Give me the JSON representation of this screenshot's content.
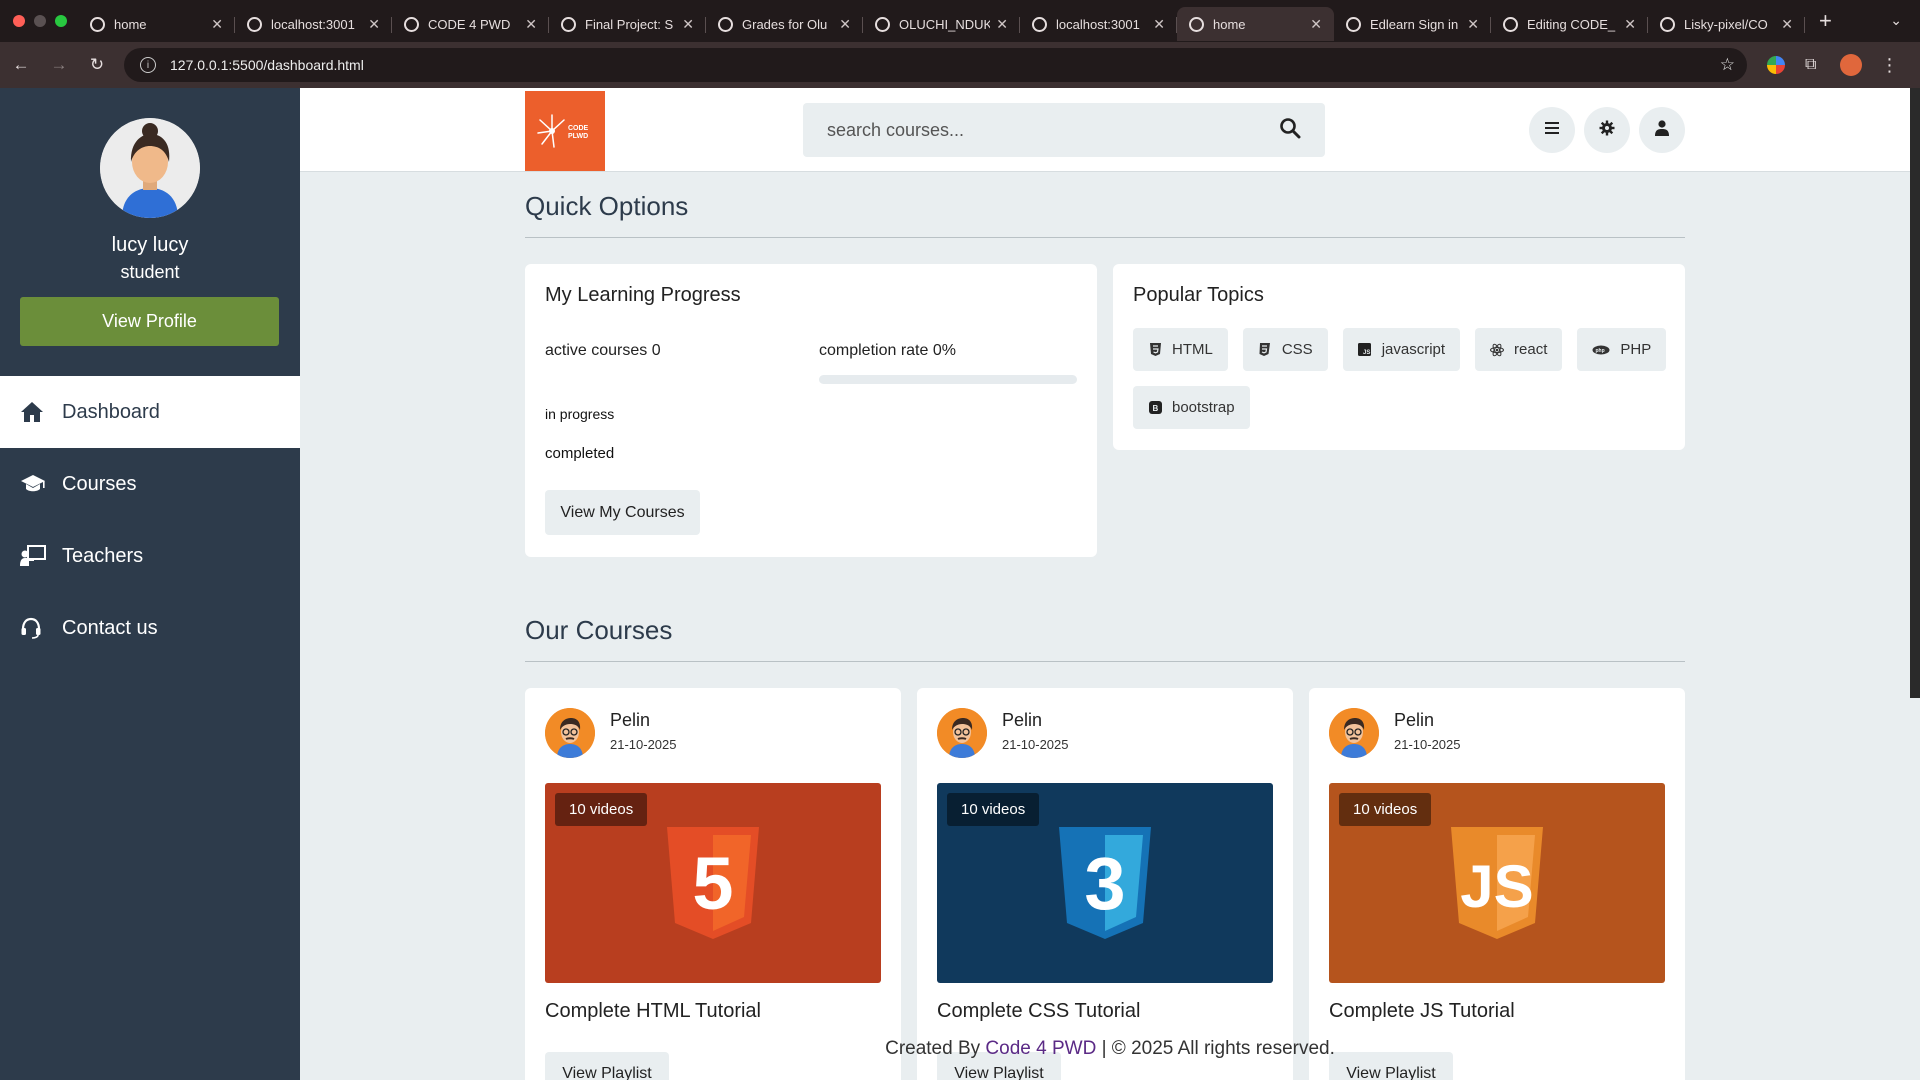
{
  "browser": {
    "tabs": [
      {
        "label": "home",
        "active": false
      },
      {
        "label": "localhost:3001",
        "active": false
      },
      {
        "label": "CODE 4 PWD",
        "active": false
      },
      {
        "label": "Final Project: S",
        "active": false
      },
      {
        "label": "Grades for Olu",
        "active": false
      },
      {
        "label": "OLUCHI_NDUK",
        "active": false
      },
      {
        "label": "localhost:3001",
        "active": false
      },
      {
        "label": "home",
        "active": true
      },
      {
        "label": "Edlearn Sign in",
        "active": false
      },
      {
        "label": "Editing CODE_",
        "active": false
      },
      {
        "label": "Lisky-pixel/CO",
        "active": false
      }
    ],
    "url": "127.0.0.1:5500/dashboard.html"
  },
  "sidebar": {
    "user_name": "lucy lucy",
    "user_role": "student",
    "view_profile_label": "View Profile",
    "nav": [
      {
        "label": "Dashboard",
        "icon": "home-icon"
      },
      {
        "label": "Courses",
        "icon": "graduation-cap-icon"
      },
      {
        "label": "Teachers",
        "icon": "chalkboard-teacher-icon"
      },
      {
        "label": "Contact us",
        "icon": "headset-icon"
      }
    ]
  },
  "header": {
    "logo_text_1": "CODE",
    "logo_text_2": "PLWD",
    "search_placeholder": "search courses..."
  },
  "quick_options": {
    "title": "Quick Options",
    "progress_card": {
      "title": "My Learning Progress",
      "active_courses_label": "active courses",
      "active_courses_value": "0",
      "completion_label": "completion rate",
      "completion_value": "0%",
      "completion_fraction": 0,
      "in_progress_label": "in progress",
      "completed_label": "completed",
      "button_label": "View My Courses"
    },
    "topics_card": {
      "title": "Popular Topics",
      "topics": [
        {
          "label": "HTML",
          "icon": "html5-icon"
        },
        {
          "label": "CSS",
          "icon": "css3-icon"
        },
        {
          "label": "javascript",
          "icon": "js-icon"
        },
        {
          "label": "react",
          "icon": "react-icon"
        },
        {
          "label": "PHP",
          "icon": "php-icon"
        },
        {
          "label": "bootstrap",
          "icon": "bootstrap-icon"
        }
      ]
    }
  },
  "courses": {
    "title": "Our Courses",
    "items": [
      {
        "author": "Pelin",
        "date": "21-10-2025",
        "videos": "10 videos",
        "title": "Complete HTML Tutorial",
        "button": "View Playlist",
        "thumb_color": "#b83e1f",
        "logo": "html5-logo",
        "logo_letter": "5"
      },
      {
        "author": "Pelin",
        "date": "21-10-2025",
        "videos": "10 videos",
        "title": "Complete CSS Tutorial",
        "button": "View Playlist",
        "thumb_color": "#10395c",
        "logo": "css3-logo",
        "logo_letter": "3"
      },
      {
        "author": "Pelin",
        "date": "21-10-2025",
        "videos": "10 videos",
        "title": "Complete JS Tutorial",
        "button": "View Playlist",
        "thumb_color": "#b5541d",
        "logo": "js-logo",
        "logo_letter": "JS"
      }
    ]
  },
  "footer": {
    "prefix": "Created By",
    "brand": "Code 4 PWD",
    "suffix": "| © 2025 All rights reserved."
  },
  "colors": {
    "sidebar_bg": "#2d3b4b",
    "accent_green": "#6b8e3a",
    "logo_orange": "#ec5f2c",
    "footer_brand": "#5b2a86"
  }
}
